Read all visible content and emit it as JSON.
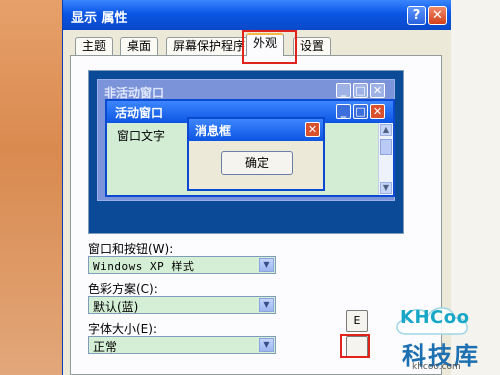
{
  "window": {
    "title": "显示 属性",
    "help_glyph": "?",
    "close_glyph": "✕"
  },
  "tabs": [
    {
      "label": "主题"
    },
    {
      "label": "桌面"
    },
    {
      "label": "屏幕保护程序"
    },
    {
      "label": "外观",
      "selected": true
    },
    {
      "label": "设置"
    }
  ],
  "preview": {
    "inactive_window_title": "非活动窗口",
    "active_window_title": "活动窗口",
    "window_text": "窗口文字",
    "message_box_title": "消息框",
    "ok_button": "确定",
    "min_glyph": "_",
    "max_glyph": "□",
    "close_glyph": "✕",
    "scroll_up": "▲",
    "scroll_down": "▼"
  },
  "form": {
    "windows_buttons_label": "窗口和按钮(W):",
    "windows_buttons_value": "Windows XP 样式",
    "color_scheme_label": "色彩方案(C):",
    "color_scheme_value": "默认(蓝)",
    "font_size_label": "字体大小(E):",
    "font_size_value": "正常",
    "dropdown_glyph": "▼"
  },
  "side_buttons": {
    "top_label": "E",
    "bottom_label": ""
  },
  "watermark": {
    "brand": "KHCoo",
    "name": "科技库",
    "domain": "khcoo.com"
  },
  "colors": {
    "titlebar_blue": "#0b56e4",
    "highlight_red": "#e0241c",
    "selection_green": "#d5efd6"
  }
}
